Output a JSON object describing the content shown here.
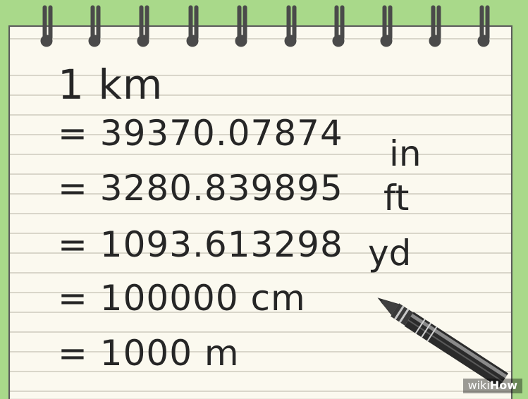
{
  "notebook": {
    "lines": [
      {
        "text": "1 km"
      },
      {
        "text": "= 39370.07874",
        "unit": "in"
      },
      {
        "text": "= 3280.839895",
        "unit": "ft"
      },
      {
        "text": "= 1093.613298",
        "unit": "yd"
      },
      {
        "text": "= 100000 cm"
      },
      {
        "text": "= 1000 m"
      }
    ]
  },
  "watermark": {
    "prefix": "wiki",
    "suffix": "How"
  },
  "colors": {
    "background": "#a9d98a",
    "paper": "#fbf9ef",
    "ink": "#262626",
    "rule_lines": "#d9d6ca",
    "spiral": "#4a4a4a"
  },
  "icons": {
    "spiral_binding": "spiral-binding-icon",
    "pencil": "pencil-icon"
  }
}
